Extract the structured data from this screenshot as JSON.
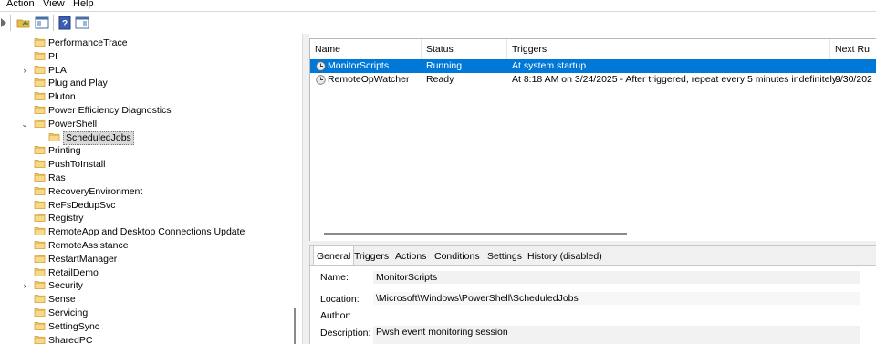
{
  "menu": [
    "Action",
    "View",
    "Help"
  ],
  "toolbar": {
    "buttons": [
      "back-icon",
      "open-folder-icon",
      "console-tree-icon",
      "help-icon",
      "action-pane-icon"
    ]
  },
  "tree": {
    "items": [
      {
        "label": "PerformanceTrace",
        "expander": ""
      },
      {
        "label": "PI",
        "expander": ""
      },
      {
        "label": "PLA",
        "expander": "›"
      },
      {
        "label": "Plug and Play",
        "expander": ""
      },
      {
        "label": "Pluton",
        "expander": ""
      },
      {
        "label": "Power Efficiency Diagnostics",
        "expander": ""
      },
      {
        "label": "PowerShell",
        "expander": "⌄"
      },
      {
        "label": "ScheduledJobs",
        "expander": "",
        "child": true,
        "selected": true
      },
      {
        "label": "Printing",
        "expander": ""
      },
      {
        "label": "PushToInstall",
        "expander": ""
      },
      {
        "label": "Ras",
        "expander": ""
      },
      {
        "label": "RecoveryEnvironment",
        "expander": ""
      },
      {
        "label": "ReFsDedupSvc",
        "expander": ""
      },
      {
        "label": "Registry",
        "expander": ""
      },
      {
        "label": "RemoteApp and Desktop Connections Update",
        "expander": ""
      },
      {
        "label": "RemoteAssistance",
        "expander": ""
      },
      {
        "label": "RestartManager",
        "expander": ""
      },
      {
        "label": "RetailDemo",
        "expander": ""
      },
      {
        "label": "Security",
        "expander": "›"
      },
      {
        "label": "Sense",
        "expander": ""
      },
      {
        "label": "Servicing",
        "expander": ""
      },
      {
        "label": "SettingSync",
        "expander": ""
      },
      {
        "label": "SharedPC",
        "expander": ""
      }
    ]
  },
  "tasks": {
    "columns": [
      "Name",
      "Status",
      "Triggers",
      "Next Ru"
    ],
    "rows": [
      {
        "name": "MonitorScripts",
        "status": "Running",
        "triggers": "At system startup",
        "next": "",
        "selected": true
      },
      {
        "name": "RemoteOpWatcher",
        "status": "Ready",
        "triggers": "At 8:18 AM on 3/24/2025 - After triggered, repeat every 5 minutes indefinitely.",
        "next": "9/30/202",
        "selected": false
      }
    ]
  },
  "details": {
    "tabs": [
      "General",
      "Triggers",
      "Actions",
      "Conditions",
      "Settings",
      "History (disabled)"
    ],
    "active_tab": "General",
    "fields": {
      "name_label": "Name:",
      "name_value": "MonitorScripts",
      "location_label": "Location:",
      "location_value": "\\Microsoft\\Windows\\PowerShell\\ScheduledJobs",
      "author_label": "Author:",
      "author_value": "",
      "description_label": "Description:",
      "description_value": "Pwsh event monitoring session"
    }
  },
  "colors": {
    "selection": "#0078d7",
    "folder": "#f2c96b",
    "folder_dark": "#d9a441"
  }
}
